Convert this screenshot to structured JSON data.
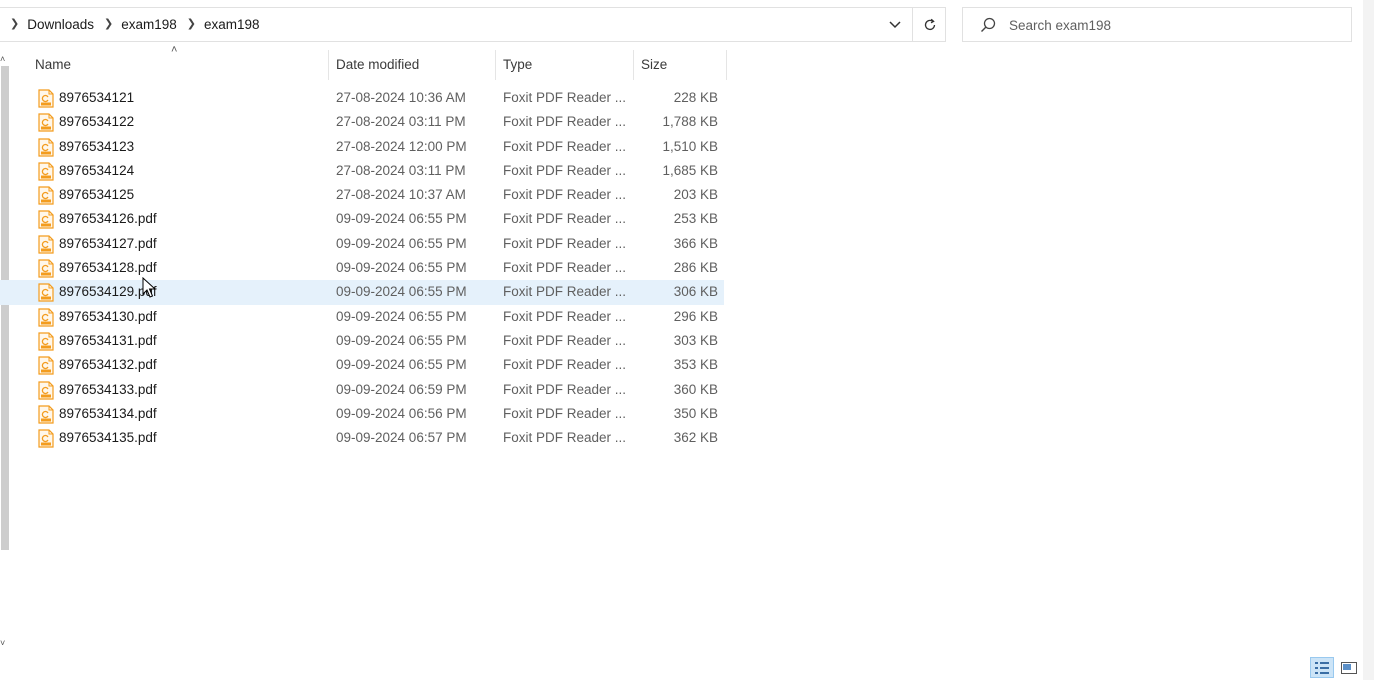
{
  "address_bar": {
    "breadcrumbs": [
      "Downloads",
      "exam198",
      "exam198"
    ]
  },
  "search": {
    "placeholder": "Search exam198"
  },
  "columns": {
    "name": "Name",
    "date_modified": "Date modified",
    "type": "Type",
    "size": "Size"
  },
  "files": [
    {
      "name": "8976534121",
      "date": "27-08-2024 10:36 AM",
      "type": "Foxit PDF Reader ...",
      "size": "228 KB"
    },
    {
      "name": "8976534122",
      "date": "27-08-2024 03:11 PM",
      "type": "Foxit PDF Reader ...",
      "size": "1,788 KB"
    },
    {
      "name": "8976534123",
      "date": "27-08-2024 12:00 PM",
      "type": "Foxit PDF Reader ...",
      "size": "1,510 KB"
    },
    {
      "name": "8976534124",
      "date": "27-08-2024 03:11 PM",
      "type": "Foxit PDF Reader ...",
      "size": "1,685 KB"
    },
    {
      "name": "8976534125",
      "date": "27-08-2024 10:37 AM",
      "type": "Foxit PDF Reader ...",
      "size": "203 KB"
    },
    {
      "name": "8976534126.pdf",
      "date": "09-09-2024 06:55 PM",
      "type": "Foxit PDF Reader ...",
      "size": "253 KB"
    },
    {
      "name": "8976534127.pdf",
      "date": "09-09-2024 06:55 PM",
      "type": "Foxit PDF Reader ...",
      "size": "366 KB"
    },
    {
      "name": "8976534128.pdf",
      "date": "09-09-2024 06:55 PM",
      "type": "Foxit PDF Reader ...",
      "size": "286 KB"
    },
    {
      "name": "8976534129.pdf",
      "date": "09-09-2024 06:55 PM",
      "type": "Foxit PDF Reader ...",
      "size": "306 KB"
    },
    {
      "name": "8976534130.pdf",
      "date": "09-09-2024 06:55 PM",
      "type": "Foxit PDF Reader ...",
      "size": "296 KB"
    },
    {
      "name": "8976534131.pdf",
      "date": "09-09-2024 06:55 PM",
      "type": "Foxit PDF Reader ...",
      "size": "303 KB"
    },
    {
      "name": "8976534132.pdf",
      "date": "09-09-2024 06:55 PM",
      "type": "Foxit PDF Reader ...",
      "size": "353 KB"
    },
    {
      "name": "8976534133.pdf",
      "date": "09-09-2024 06:59 PM",
      "type": "Foxit PDF Reader ...",
      "size": "360 KB"
    },
    {
      "name": "8976534134.pdf",
      "date": "09-09-2024 06:56 PM",
      "type": "Foxit PDF Reader ...",
      "size": "350 KB"
    },
    {
      "name": "8976534135.pdf",
      "date": "09-09-2024 06:57 PM",
      "type": "Foxit PDF Reader ...",
      "size": "362 KB"
    }
  ],
  "hovered_row_index": 8,
  "icons": {
    "file": "foxit-pdf-file-icon",
    "search": "search-icon",
    "refresh": "refresh-icon",
    "dropdown": "chevron-down-icon"
  },
  "colors": {
    "hover_row": "#e5f1fb",
    "file_icon": "#f39c1e",
    "view_active": "#cce4f7"
  }
}
